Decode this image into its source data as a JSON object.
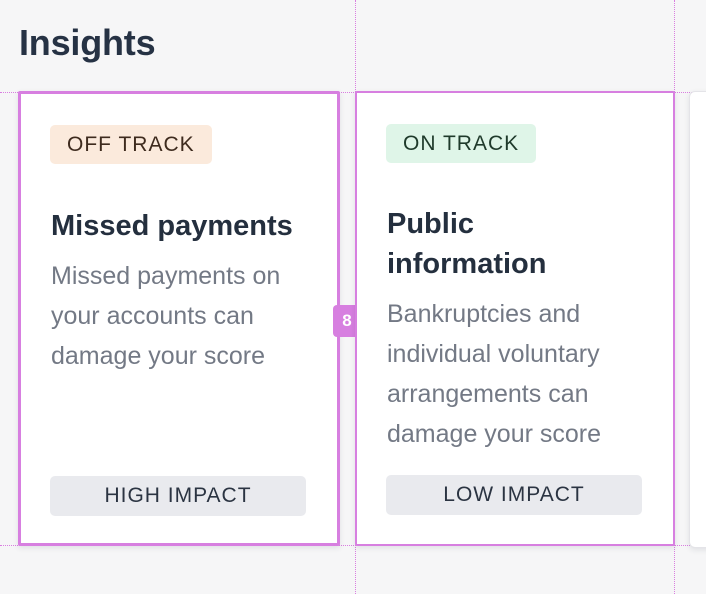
{
  "page": {
    "title": "Insights"
  },
  "cards": [
    {
      "status": "OFF TRACK",
      "title": "Missed payments",
      "description": "Missed payments on your accounts can damage your score",
      "impact": "HIGH IMPACT"
    },
    {
      "status": "ON TRACK",
      "title": "Public information",
      "description": "Bankruptcies and individual voluntary arrangements can damage your score",
      "impact": "LOW IMPACT"
    }
  ],
  "spacing_badge": {
    "value": "8"
  },
  "colors": {
    "off_track_bg": "#fbeadc",
    "on_track_bg": "#dff5e8",
    "impact_bg": "#e9eaee",
    "guide": "#d77fe0"
  }
}
